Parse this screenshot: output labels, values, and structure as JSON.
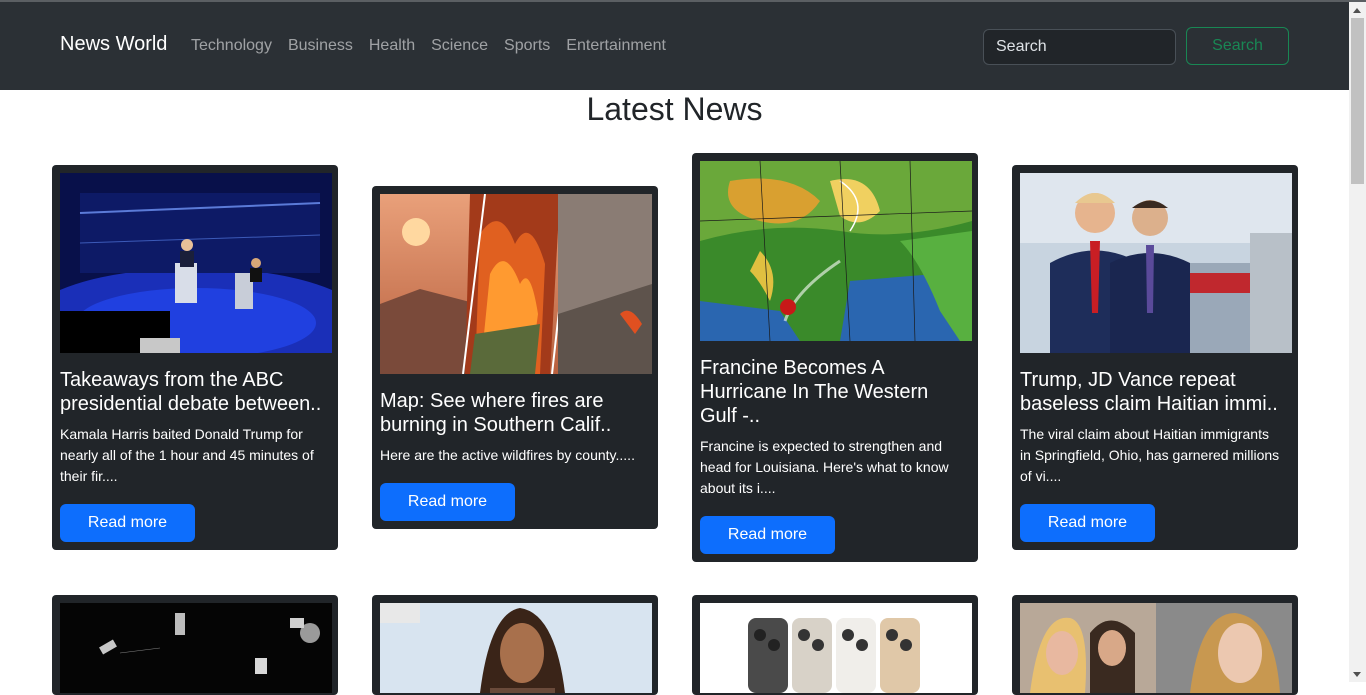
{
  "navbar": {
    "brand": "News World",
    "links": [
      "Technology",
      "Business",
      "Health",
      "Science",
      "Sports",
      "Entertainment"
    ],
    "search_placeholder": "Search",
    "search_button": "Search"
  },
  "page": {
    "heading": "Latest News"
  },
  "articles": [
    {
      "title": "Takeaways from the ABC presidential debate between..",
      "description": "Kamala Harris baited Donald Trump for nearly all of the 1 hour and 45 minutes of their fir....",
      "button": "Read more"
    },
    {
      "title": "Map: See where fires are burning in Southern Calif..",
      "description": "Here are the active wildfires by county.....",
      "button": "Read more"
    },
    {
      "title": "Francine Becomes A Hurricane In The Western Gulf -..",
      "description": "Francine is expected to strengthen and head for Louisiana. Here's what to know about its i....",
      "button": "Read more"
    },
    {
      "title": "Trump, JD Vance repeat baseless claim Haitian immi..",
      "description": "The viral claim about Haitian immigrants in Springfield, Ohio, has garnered millions of vi....",
      "button": "Read more"
    }
  ],
  "colors": {
    "navbar_bg": "#2b3035",
    "card_bg": "#212529",
    "primary": "#0d6efd",
    "success": "#198754"
  }
}
